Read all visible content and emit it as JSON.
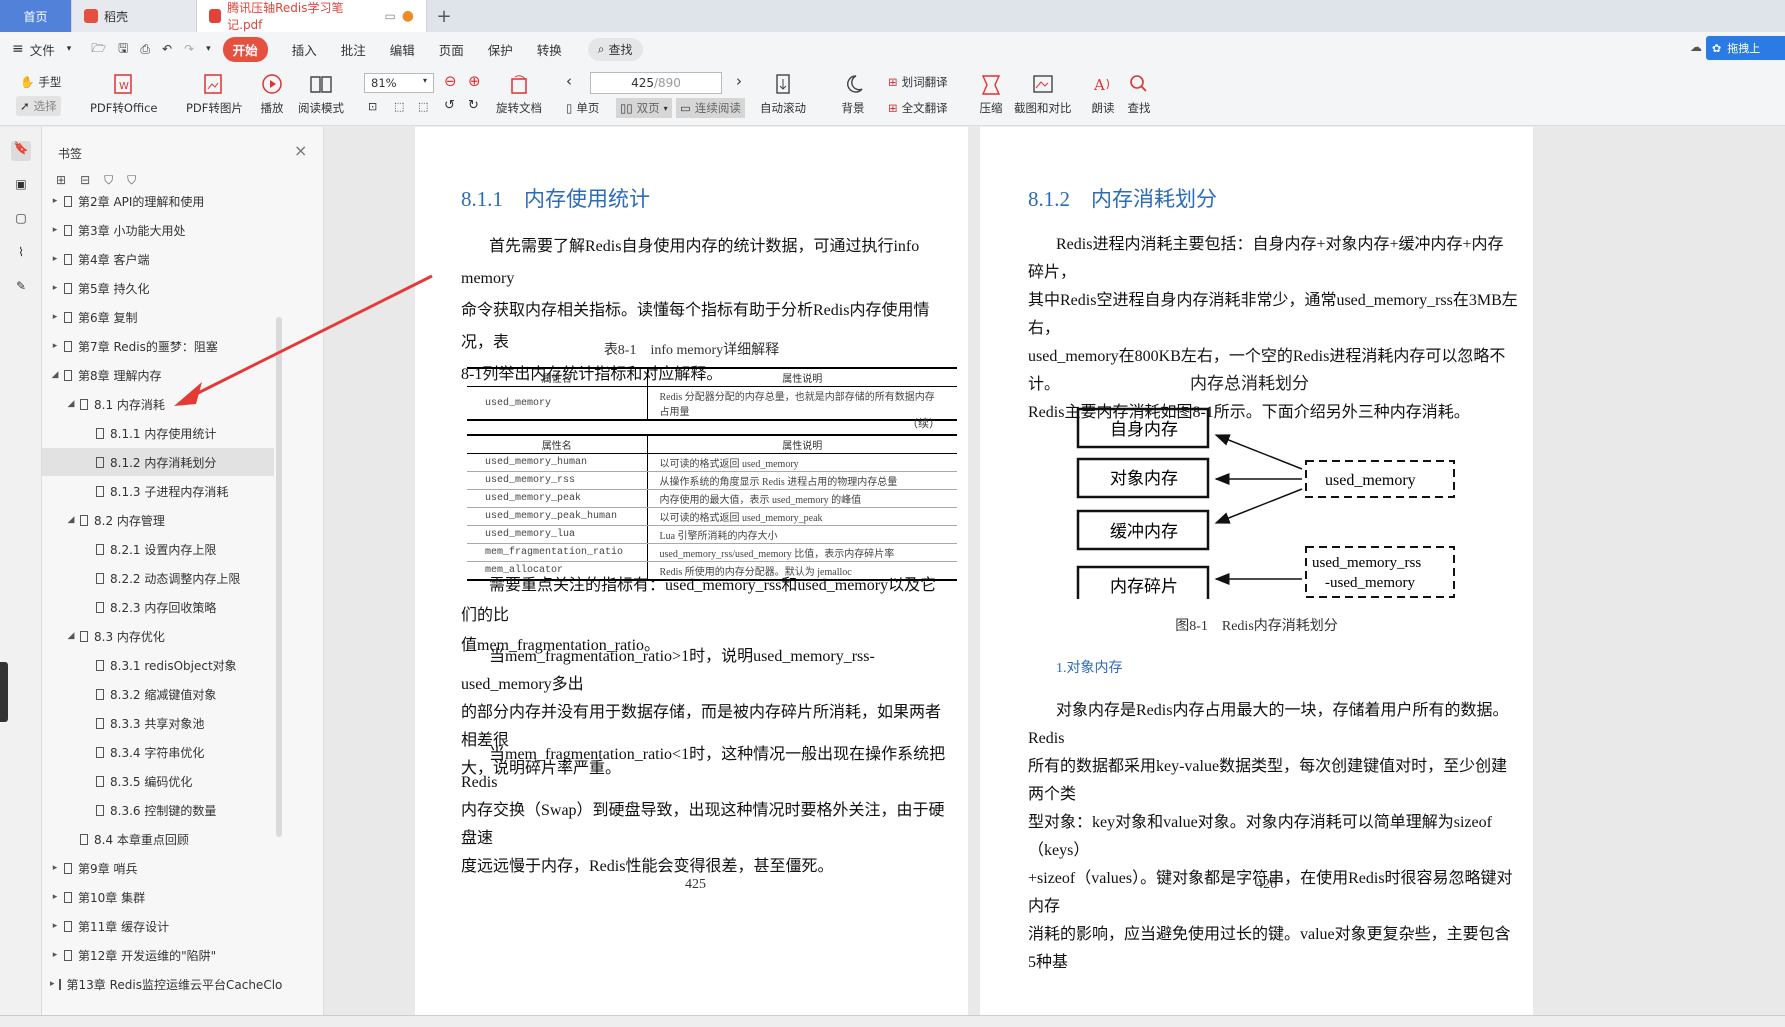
{
  "tabs": {
    "home": "首页",
    "docer": "稻壳",
    "doc": "腾讯压轴Redis学习笔记.pdf",
    "plus": "+"
  },
  "menu": {
    "file": "文件",
    "items": [
      "开始",
      "插入",
      "批注",
      "编辑",
      "页面",
      "保护",
      "转换"
    ],
    "search": "查找",
    "topright": "拖拽上"
  },
  "ribbon": {
    "hand": "手型",
    "select": "选择",
    "pdf2office": "PDF转Office",
    "pdf2img": "PDF转图片",
    "play": "播放",
    "readmode": "阅读模式",
    "zoom": "81%",
    "page_input": "425",
    "page_total": "/890",
    "rotate": "旋转文档",
    "single": "单页",
    "double": "双页",
    "continuous": "连续阅读",
    "autoscroll": "自动滚动",
    "bg": "背景",
    "wordtrans": "划词翻译",
    "fulltrans": "全文翻译",
    "compress": "压缩",
    "screenshot": "截图和对比",
    "read": "朗读",
    "find": "查找"
  },
  "colors": {
    "accent": "#e55140",
    "link": "#2b6cb9",
    "arrow": "#e53935"
  },
  "bookmarks_panel": {
    "title": "书签",
    "items": [
      {
        "label": "第2章 API的理解和使用",
        "level": 0,
        "state": "collapsed"
      },
      {
        "label": "第3章 小功能大用处",
        "level": 0,
        "state": "collapsed"
      },
      {
        "label": "第4章 客户端",
        "level": 0,
        "state": "collapsed"
      },
      {
        "label": "第5章 持久化",
        "level": 0,
        "state": "collapsed"
      },
      {
        "label": "第6章 复制",
        "level": 0,
        "state": "collapsed"
      },
      {
        "label": "第7章 Redis的噩梦：阻塞",
        "level": 0,
        "state": "collapsed"
      },
      {
        "label": "第8章 理解内存",
        "level": 0,
        "state": "expanded"
      },
      {
        "label": "8.1 内存消耗",
        "level": 1,
        "state": "expanded"
      },
      {
        "label": "8.1.1 内存使用统计",
        "level": 2,
        "state": "leaf"
      },
      {
        "label": "8.1.2 内存消耗划分",
        "level": 2,
        "state": "selected"
      },
      {
        "label": "8.1.3 子进程内存消耗",
        "level": 2,
        "state": "leaf"
      },
      {
        "label": "8.2 内存管理",
        "level": 1,
        "state": "expanded"
      },
      {
        "label": "8.2.1 设置内存上限",
        "level": 2,
        "state": "leaf"
      },
      {
        "label": "8.2.2 动态调整内存上限",
        "level": 2,
        "state": "leaf"
      },
      {
        "label": "8.2.3 内存回收策略",
        "level": 2,
        "state": "leaf"
      },
      {
        "label": "8.3 内存优化",
        "level": 1,
        "state": "expanded"
      },
      {
        "label": "8.3.1 redisObject对象",
        "level": 2,
        "state": "leaf"
      },
      {
        "label": "8.3.2 缩减键值对象",
        "level": 2,
        "state": "leaf"
      },
      {
        "label": "8.3.3 共享对象池",
        "level": 2,
        "state": "leaf"
      },
      {
        "label": "8.3.4 字符串优化",
        "level": 2,
        "state": "leaf"
      },
      {
        "label": "8.3.5 编码优化",
        "level": 2,
        "state": "leaf"
      },
      {
        "label": "8.3.6 控制键的数量",
        "level": 2,
        "state": "leaf"
      },
      {
        "label": "8.4 本章重点回顾",
        "level": 1,
        "state": "leaf"
      },
      {
        "label": "第9章 哨兵",
        "level": 0,
        "state": "collapsed"
      },
      {
        "label": "第10章 集群",
        "level": 0,
        "state": "collapsed"
      },
      {
        "label": "第11章 缓存设计",
        "level": 0,
        "state": "collapsed"
      },
      {
        "label": "第12章 开发运维的\"陷阱\"",
        "level": 0,
        "state": "collapsed"
      },
      {
        "label": "第13章 Redis监控运维云平台CacheClo",
        "level": 0,
        "state": "collapsed"
      }
    ]
  },
  "left_page": {
    "heading": "8.1.1　内存使用统计",
    "p1": [
      "首先需要了解Redis自身使用内存的统计数据，可通过执行info memory",
      "命令获取内存相关指标。读懂每个指标有助于分析Redis内存使用情况，表",
      "8-1列举出内存统计指标和对应解释。"
    ],
    "table_caption": "表8-1　info memory详细解释",
    "table_headers": [
      "属性名",
      "属性说明"
    ],
    "table_row1": [
      "used_memory",
      "Redis 分配器分配的内存总量，也就是内部存储的所有数据内存占用量"
    ],
    "cont": "（续）",
    "table_rows": [
      [
        "used_memory_human",
        "以可读的格式返回 used_memory"
      ],
      [
        "used_memory_rss",
        "从操作系统的角度显示 Redis 进程占用的物理内存总量"
      ],
      [
        "used_memory_peak",
        "内存使用的最大值，表示 used_memory 的峰值"
      ],
      [
        "used_memory_peak_human",
        "以可读的格式返回 used_memory_peak"
      ],
      [
        "used_memory_lua",
        "Lua 引擎所消耗的内存大小"
      ],
      [
        "mem_fragmentation_ratio",
        "used_memory_rss/used_memory 比值，表示内存碎片率"
      ],
      [
        "mem_allocator",
        "Redis 所使用的内存分配器。默认为 jemalloc"
      ]
    ],
    "p2": [
      "需要重点关注的指标有：used_memory_rss和used_memory以及它们的比",
      "值mem_fragmentation_ratio。"
    ],
    "p3": [
      "当mem_fragmentation_ratio>1时，说明used_memory_rss-used_memory多出",
      "的部分内存并没有用于数据存储，而是被内存碎片所消耗，如果两者相差很",
      "大，说明碎片率严重。"
    ],
    "p4": [
      "当mem_fragmentation_ratio<1时，这种情况一般出现在操作系统把Redis",
      "内存交换（Swap）到硬盘导致，出现这种情况时要格外关注，由于硬盘速",
      "度远远慢于内存，Redis性能会变得很差，甚至僵死。"
    ],
    "page_no": "425"
  },
  "right_page": {
    "heading": "8.1.2　内存消耗划分",
    "p1": [
      "Redis进程内消耗主要包括：自身内存+对象内存+缓冲内存+内存碎片，",
      "其中Redis空进程自身内存消耗非常少，通常used_memory_rss在3MB左右，",
      "used_memory在800KB左右，一个空的Redis进程消耗内存可以忽略不计。",
      "Redis主要内存消耗如图8-1所示。下面介绍另外三种内存消耗。"
    ],
    "diagram": {
      "title": "内存总消耗划分",
      "boxes": [
        "自身内存",
        "对象内存",
        "缓冲内存",
        "内存碎片"
      ],
      "label1": "used_memory",
      "label2a": "used_memory_rss",
      "label2b": "-used_memory"
    },
    "fig_caption": "图8-1　Redis内存消耗划分",
    "sub_heading": "1.对象内存",
    "p2": [
      "对象内存是Redis内存占用最大的一块，存储着用户所有的数据。Redis",
      "所有的数据都采用key-value数据类型，每次创建键值对时，至少创建两个类",
      "型对象：key对象和value对象。对象内存消耗可以简单理解为sizeof（keys）",
      "+sizeof（values）。键对象都是字符串，在使用Redis时很容易忽略键对内存",
      "消耗的影响，应当避免使用过长的键。value对象更复杂些，主要包含5种基"
    ],
    "page_no": "426"
  }
}
